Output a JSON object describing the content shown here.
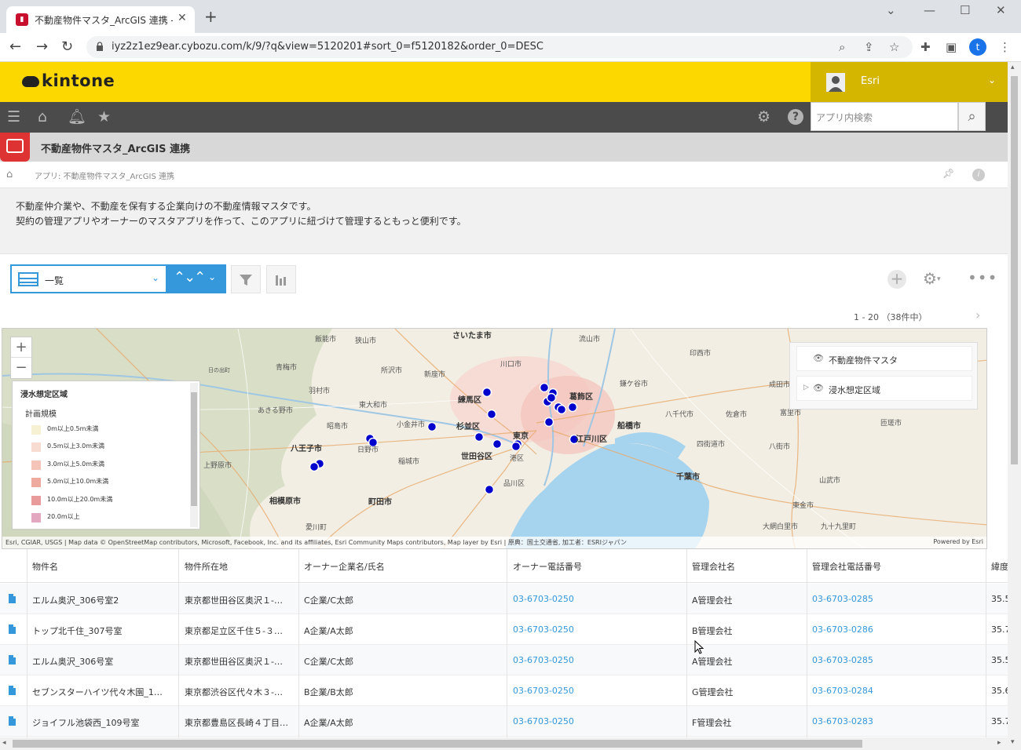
{
  "browser": {
    "tab_title": "不動産物件マスタ_ArcGIS 連携 - k",
    "favicon": "kintone-app-favicon",
    "url": "iyz2z1ez9ear.cybozu.com/k/9/?q&view=5120201#sort_0=f5120182&order_0=DESC",
    "profile_initial": "t"
  },
  "header": {
    "logo": "kintone",
    "user_name": "Esri",
    "search_placeholder": "アプリ内検索"
  },
  "app": {
    "title": "不動産物件マスタ_ArcGIS 連携",
    "breadcrumb": "アプリ: 不動産物件マスタ_ArcGIS 連携",
    "description_line1": "不動産仲介業や、不動産を保有する企業向けの不動産情報マスタです。",
    "description_line2": "契約の管理アプリやオーナーのマスタアプリを作って、このアプリに紐づけて管理するともっと便利です。"
  },
  "toolbar": {
    "view_name": "一覧",
    "pager": "1 - 20 （38件中）"
  },
  "map": {
    "legend": {
      "title": "浸水想定区域",
      "subtitle": "計画規模",
      "items": [
        {
          "label": "0m以上0.5m未満",
          "color": "#f7f1d4"
        },
        {
          "label": "0.5m以上3.0m未満",
          "color": "#f8dcd2"
        },
        {
          "label": "3.0m以上5.0m未満",
          "color": "#f4c4b8"
        },
        {
          "label": "5.0m以上10.0m未満",
          "color": "#efaaa0"
        },
        {
          "label": "10.0m以上20.0m未満",
          "color": "#e99b9b"
        },
        {
          "label": "20.0m以上",
          "color": "#e3a8c0"
        }
      ]
    },
    "layers": [
      {
        "label": "不動産物件マスタ"
      },
      {
        "label": "浸水想定区域"
      }
    ],
    "attribution": "Esri, CGIAR, USGS | Map data © OpenStreetMap contributors, Microsoft, Facebook, Inc. and its affiliates, Esri Community Maps contributors, Map layer by Esri | 原典：国土交通省, 加工者：ESRIジャパン",
    "powered_by": "Powered by Esri",
    "labels": [
      {
        "text": "さいたま市",
        "bold": true
      },
      {
        "text": "飯能市"
      },
      {
        "text": "狭山市"
      },
      {
        "text": "流山市"
      },
      {
        "text": "青梅市"
      },
      {
        "text": "所沢市"
      },
      {
        "text": "新座市"
      },
      {
        "text": "川口市"
      },
      {
        "text": "印西市"
      },
      {
        "text": "日の出町"
      },
      {
        "text": "羽村市"
      },
      {
        "text": "東大和市"
      },
      {
        "text": "練馬区",
        "bold": true
      },
      {
        "text": "葛飾区",
        "bold": true
      },
      {
        "text": "鎌ケ谷市"
      },
      {
        "text": "成田市"
      },
      {
        "text": "あきる野市"
      },
      {
        "text": "八千代市"
      },
      {
        "text": "佐倉市"
      },
      {
        "text": "富里市"
      },
      {
        "text": "昭島市"
      },
      {
        "text": "小金井市"
      },
      {
        "text": "杉並区",
        "bold": true
      },
      {
        "text": "船橋市",
        "bold": true
      },
      {
        "text": "東京",
        "bold": true
      },
      {
        "text": "江戸川区",
        "bold": true
      },
      {
        "text": "八王子市",
        "bold": true
      },
      {
        "text": "日野市"
      },
      {
        "text": "世田谷区",
        "bold": true
      },
      {
        "text": "港区"
      },
      {
        "text": "四街道市"
      },
      {
        "text": "八街市"
      },
      {
        "text": "匝瑳市"
      },
      {
        "text": "上野原市"
      },
      {
        "text": "稲城市"
      },
      {
        "text": "千葉市",
        "bold": true
      },
      {
        "text": "品川区"
      },
      {
        "text": "山武市"
      },
      {
        "text": "相模原市",
        "bold": true
      },
      {
        "text": "町田市",
        "bold": true
      },
      {
        "text": "東金市"
      },
      {
        "text": "愛川町"
      },
      {
        "text": "大網白里市"
      },
      {
        "text": "九十九里町"
      }
    ],
    "point_count": 21
  },
  "table": {
    "columns": [
      "物件名",
      "物件所在地",
      "オーナー企業名/氏名",
      "オーナー電話番号",
      "管理会社名",
      "管理会社電話番号",
      "緯度"
    ],
    "rows": [
      [
        "エルム奥沢_306号室2",
        "東京都世田谷区奥沢１-…",
        "C企業/C太郎",
        "03-6703-0250",
        "A管理会社",
        "03-6703-0285",
        "35.5"
      ],
      [
        "トップ北千住_307号室",
        "東京都足立区千住５-３…",
        "A企業/A太郎",
        "03-6703-0250",
        "B管理会社",
        "03-6703-0286",
        "35.7"
      ],
      [
        "エルム奥沢_306号室",
        "東京都世田谷区奥沢１-…",
        "C企業/C太郎",
        "03-6703-0250",
        "A管理会社",
        "03-6703-0285",
        "35.5"
      ],
      [
        "セブンスターハイツ代々木園_1…",
        "東京都渋谷区代々木３-…",
        "B企業/B太郎",
        "03-6703-0250",
        "G管理会社",
        "03-6703-0284",
        "35.6"
      ],
      [
        "ジョイフル池袋西_109号室",
        "東京都豊島区長崎４丁目…",
        "A企業/A太郎",
        "03-6703-0250",
        "F管理会社",
        "03-6703-0283",
        "35.7"
      ]
    ]
  },
  "colors": {
    "kintone_yellow": "#fcd700",
    "accent_blue": "#3498db",
    "point_blue": "#0000cc"
  }
}
